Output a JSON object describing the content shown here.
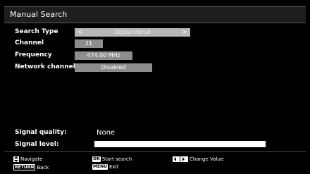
{
  "header": {
    "title": "Manual Search"
  },
  "fields": [
    {
      "label": "Search Type",
      "value": "Digital Aerial",
      "has_arrows": true
    },
    {
      "label": "Channel",
      "value": "21"
    },
    {
      "label": "Frequency",
      "value": "474.00 MHz"
    },
    {
      "label": "Network channel scan",
      "value": "Disabled"
    }
  ],
  "arrows": {
    "left": "<",
    "right": ">"
  },
  "signal": {
    "quality_label": "Signal quality:",
    "quality_value": "None",
    "level_label": "Signal level:",
    "level": 1.0
  },
  "footer": {
    "navigate_label": "Navigate",
    "return_key": "RETURN",
    "back_label": "Back",
    "ok_key": "OK",
    "start_search_label": "Start search",
    "menu_key": "MENU",
    "exit_label": "Exit",
    "change_value_label": "Change Value"
  },
  "icons": {
    "navigate": "up-down-arrows-icon",
    "change_value": "left-right-arrows-icon"
  }
}
